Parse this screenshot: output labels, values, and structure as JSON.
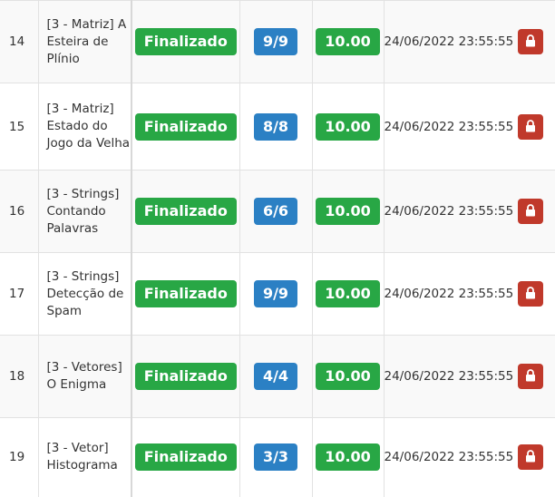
{
  "rows": [
    {
      "num": "14",
      "name": "[3 - Matriz] A Esteira de Plínio",
      "status": "Finalizado",
      "score": "9/9",
      "grade": "10.00",
      "date": "24/06/2022 23:55:55"
    },
    {
      "num": "15",
      "name": "[3 - Matriz] Estado do Jogo da Velha",
      "status": "Finalizado",
      "score": "8/8",
      "grade": "10.00",
      "date": "24/06/2022 23:55:55"
    },
    {
      "num": "16",
      "name": "[3 - Strings] Contando Palavras",
      "status": "Finalizado",
      "score": "6/6",
      "grade": "10.00",
      "date": "24/06/2022 23:55:55"
    },
    {
      "num": "17",
      "name": "[3 - Strings] Detecção de Spam",
      "status": "Finalizado",
      "score": "9/9",
      "grade": "10.00",
      "date": "24/06/2022 23:55:55"
    },
    {
      "num": "18",
      "name": "[3 - Vetores] O Enigma",
      "status": "Finalizado",
      "score": "4/4",
      "grade": "10.00",
      "date": "24/06/2022 23:55:55"
    },
    {
      "num": "19",
      "name": "[3 - Vetor] Histograma",
      "status": "Finalizado",
      "score": "3/3",
      "grade": "10.00",
      "date": "24/06/2022 23:55:55"
    }
  ],
  "icons": {
    "lock": "lock-icon"
  },
  "colors": {
    "success": "#28a745",
    "primary": "#2b80c4",
    "danger": "#c0392b"
  }
}
